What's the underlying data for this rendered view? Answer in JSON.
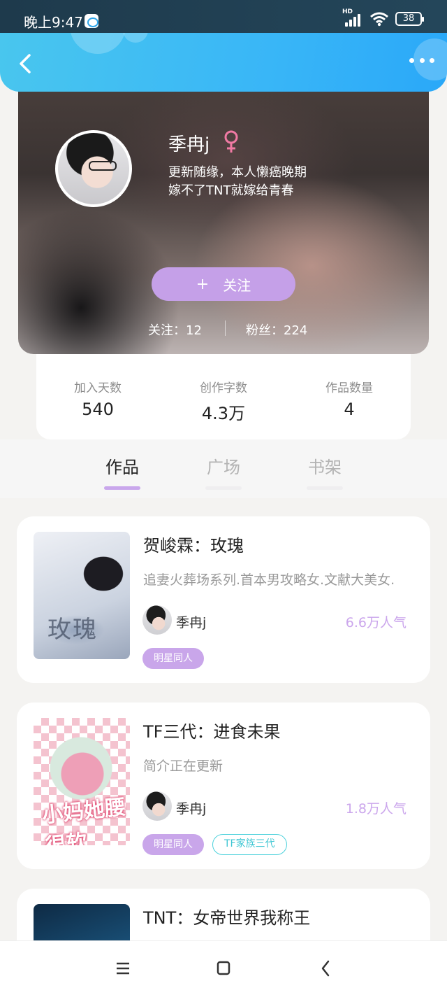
{
  "status_bar": {
    "time": "晚上9:47",
    "network": "HD",
    "battery": "38"
  },
  "header": {
    "back_icon": "chevron-left-icon",
    "more_icon": "more-dots-icon"
  },
  "profile": {
    "name": "季冉j",
    "gender_icon": "female-icon",
    "bio_line1": "更新随缘，本人懒癌晚期",
    "bio_line2": "嫁不了TNT就嫁给青春",
    "follow_plus": "+",
    "follow_label": "关注",
    "following": "关注：12",
    "fans": "粉丝：224"
  },
  "stats": [
    {
      "label": "加入天数",
      "value": "540"
    },
    {
      "label": "创作字数",
      "value": "4.3万"
    },
    {
      "label": "作品数量",
      "value": "4"
    }
  ],
  "tabs": [
    {
      "label": "作品",
      "active": true
    },
    {
      "label": "广场",
      "active": false
    },
    {
      "label": "书架",
      "active": false
    }
  ],
  "books": [
    {
      "title": "贺峻霖：玫瑰",
      "description": "追妻火葬场系列.首本男攻略女.文献大美女.",
      "author": "季冉j",
      "popularity": "6.6万人气",
      "tags": [
        "明星同人"
      ],
      "cover_text": "玫瑰"
    },
    {
      "title": "TF三代：进食未果",
      "description": "简介正在更新",
      "author": "季冉j",
      "popularity": "1.8万人气",
      "tags": [
        "明星同人",
        "TF家族三代"
      ],
      "cover_text": "小妈她腰很软"
    },
    {
      "title": "TNT：女帝世界我称王"
    }
  ],
  "colors": {
    "header": "#39b6f7",
    "accent_purple": "#c5a0e8",
    "tag_cyan": "#4ed2dc"
  },
  "nav_bar": {
    "menu_icon": "menu-icon",
    "home_icon": "home-square-icon",
    "back_icon": "back-triangle-icon"
  }
}
